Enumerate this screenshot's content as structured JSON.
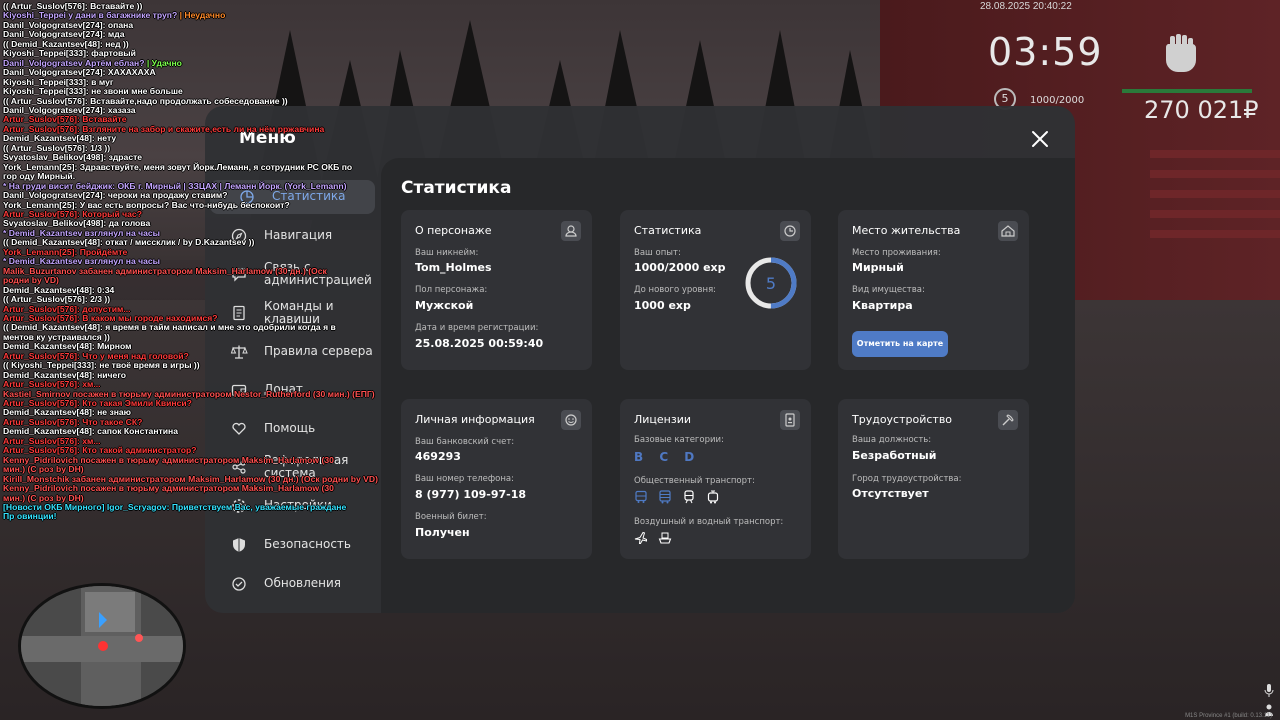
{
  "chat": [
    {
      "text": "(( Artur_Suslov[576]: Вставайте ))",
      "color": "white"
    },
    {
      "text": "Kiyoshi_Teppei у дани в багажнике труп?",
      "suffix": " | Неудачно",
      "color": "purple",
      "suffix_color": "orange"
    },
    {
      "text": "Danil_Volgogratsev[274]: опана",
      "color": "white"
    },
    {
      "text": "Danil_Volgogratsev[274]: мда",
      "color": "white"
    },
    {
      "text": "(( Demid_Kazantsev[48]: нед ))",
      "color": "white"
    },
    {
      "text": "Kiyoshi_Teppei[333]: фартовый",
      "color": "white"
    },
    {
      "text": "Danil_Volgogratsev Артём еблан?",
      "suffix": " | Удачно",
      "color": "purple",
      "suffix_color": "green"
    },
    {
      "text": "Danil_Volgogratsev[274]: ХАХАХАХА",
      "color": "white"
    },
    {
      "text": "Kiyoshi_Teppei[333]: в муг",
      "color": "white"
    },
    {
      "text": "Kiyoshi_Teppei[333]: не звони мне больше",
      "color": "white"
    },
    {
      "text": "(( Artur_Suslov[576]: Вставайте,надо продолжать собеседование ))",
      "color": "white"
    },
    {
      "text": "Danil_Volgogratsev[274]: хазаза",
      "color": "white"
    },
    {
      "text": "Artur_Suslov[576]: Вставайте",
      "color": "red"
    },
    {
      "text": "Artur_Suslov[576]: Взгляните на забор и скажите,есть ли на нём рржавчина",
      "color": "red"
    },
    {
      "text": "Demid_Kazantsev[48]: нету",
      "color": "white"
    },
    {
      "text": "(( Artur_Suslov[576]: 1/3 ))",
      "color": "white"
    },
    {
      "text": "Svyatoslav_Belikov[498]: здрасте",
      "color": "white"
    },
    {
      "text": "York_Lemann[25]: Здравствуйте, меня зовут Йорк.Леманн, я сотрудник РС ОКБ по гор оду Мирный.",
      "color": "white",
      "wrap": true
    },
    {
      "text": "* На груди висит бейджик: ОКБ г. Мирный | ЗЗЦАХ | Леманн Йорк. (York_Lemann)",
      "color": "purple"
    },
    {
      "text": "Danil_Volgogratsev[274]: чероки на продажу ставим?",
      "color": "white"
    },
    {
      "text": "York_Lemann[25]: У вас есть вопросы? Вас что-нибудь беспокоит?",
      "color": "white"
    },
    {
      "text": "Artur_Suslov[576]: Который час?",
      "color": "red"
    },
    {
      "text": "Svyatoslav_Belikov[498]: да голова",
      "color": "white"
    },
    {
      "text": "* Demid_Kazantsev взглянул на часы",
      "color": "purple"
    },
    {
      "text": "(( Demid_Kazantsev[48]: откат / мисcклик / by D.Kazantsev ))",
      "color": "white"
    },
    {
      "text": "York_Lemann[25]: Пройдёмте",
      "color": "red"
    },
    {
      "text": "* Demid_Kazantsev взглянул на часы",
      "color": "purple"
    },
    {
      "text": "Malik_Buzurtanov забанен администратором Maksim_Harlamow (30 дн.) (Оск родни by VD)",
      "color": "red2",
      "wrap": true
    },
    {
      "text": "Demid_Kazantsev[48]: 0:34",
      "color": "white"
    },
    {
      "text": "(( Artur_Suslov[576]: 2/3 ))",
      "color": "white"
    },
    {
      "text": "Artur_Suslov[576]: допустим...",
      "color": "red"
    },
    {
      "text": "Artur_Suslov[576]: В каком мы городе находимся?",
      "color": "red"
    },
    {
      "text": "(( Demid_Kazantsev[48]: я время в тайм написал и мне это одобрили когда я в ментов ку устраивался ))",
      "color": "white",
      "wrap": true
    },
    {
      "text": "Demid_Kazantsev[48]: Мирном",
      "color": "white"
    },
    {
      "text": "Artur_Suslov[576]: Что у меня над головой?",
      "color": "red"
    },
    {
      "text": "(( Kiyoshi_Teppei[333]: не твоё время в игры ))",
      "color": "white"
    },
    {
      "text": "Demid_Kazantsev[48]: ничего",
      "color": "white"
    },
    {
      "text": "Artur_Suslov[576]: хм...",
      "color": "red"
    },
    {
      "text": "Kastiel_Smirnov посажен в тюрьму администратором Nestor_Rutherford (30 мин.) (ЕПГ)",
      "color": "red2"
    },
    {
      "text": "Artur_Suslov[576]: Кто такая Эмили Квинси?",
      "color": "red"
    },
    {
      "text": "Demid_Kazantsev[48]: не знаю",
      "color": "white"
    },
    {
      "text": "Artur_Suslov[576]: Что такое СК?",
      "color": "red"
    },
    {
      "text": "Demid_Kazantsev[48]: сапок Константина",
      "color": "white"
    },
    {
      "text": "Artur_Suslov[576]: хм...",
      "color": "red"
    },
    {
      "text": "Artur_Suslov[576]: Кто такой администратор?",
      "color": "red"
    },
    {
      "text": "Kenny_Pidrilovich посажен в тюрьму администратором Maksim_Harlamow (30 мин.) (С роз by DH)",
      "color": "red2",
      "wrap": true
    },
    {
      "text": "Kirill_Monstchik забанен администратором Maksim_Harlamow (30 дн.) (Оск родни by VD)",
      "color": "red2"
    },
    {
      "text": "Kenny_Pidrilovich посажен в тюрьму администратором Maksim_Harlamow (30 мин.) (С роз by DH)",
      "color": "red2",
      "wrap": true
    },
    {
      "text": "[Новости ОКБ Мирного] Igor_Scryagov: Приветствуем Вас, уважаемые граждане Пр овинции!",
      "color": "cyan",
      "wrap": true
    }
  ],
  "hud": {
    "datetime": "28.08.2025 20:40:22",
    "clock": "03:59",
    "level": "5",
    "exp": "1000/2000",
    "money": "270 021₽"
  },
  "menu": {
    "title": "Меню",
    "sidebar": [
      {
        "label": "Статистика",
        "icon": "pie-chart-icon",
        "active": true
      },
      {
        "label": "Навигация",
        "icon": "compass-icon"
      },
      {
        "label": "Связь с администрацией",
        "icon": "chat-icon"
      },
      {
        "label": "Команды и клавиши",
        "icon": "document-icon"
      },
      {
        "label": "Правила сервера",
        "icon": "scales-icon"
      },
      {
        "label": "Донат",
        "icon": "wallet-icon"
      },
      {
        "label": "Помощь",
        "icon": "heart-hand-icon"
      },
      {
        "label": "Реферальная система",
        "icon": "referral-icon"
      },
      {
        "label": "Настройки",
        "icon": "gear-icon"
      },
      {
        "label": "Безопасность",
        "icon": "shield-icon"
      },
      {
        "label": "Обновления",
        "icon": "refresh-icon"
      }
    ]
  },
  "stats": {
    "title": "Статистика",
    "character": {
      "title": "О персонаже",
      "nick_label": "Ваш никнейм:",
      "nick": "Tom_Holmes",
      "gender_label": "Пол персонажа:",
      "gender": "Мужской",
      "reg_label": "Дата и время регистрации:",
      "reg": "25.08.2025 00:59:40"
    },
    "statistics": {
      "title": "Статистика",
      "exp_label": "Ваш опыт:",
      "exp": "1000/2000 exp",
      "next_label": "До нового уровня:",
      "next": "1000 exp",
      "level": "5",
      "progress": 0.5
    },
    "residence": {
      "title": "Место жительства",
      "place_label": "Место проживания:",
      "place": "Мирный",
      "property_label": "Вид имущества:",
      "property": "Квартира",
      "map_button": "Отметить на карте"
    },
    "personal": {
      "title": "Личная информация",
      "bank_label": "Ваш банковский счет:",
      "bank": "469293",
      "phone_label": "Ваш номер телефона:",
      "phone": "8 (977) 109-97-18",
      "military_label": "Военный билет:",
      "military": "Получен"
    },
    "licenses": {
      "title": "Лицензии",
      "base_label": "Базовые категории:",
      "base": "B C D",
      "public_label": "Общественный транспорт:",
      "air_label": "Воздушный и водный транспорт:"
    },
    "job": {
      "title": "Трудоустройство",
      "position_label": "Ваша должность:",
      "position": "Безработный",
      "employer_label": "Город трудоустройства:",
      "employer": "Отсутствует"
    }
  },
  "footer": "M1S Province #1 (build: 0.13.11)"
}
